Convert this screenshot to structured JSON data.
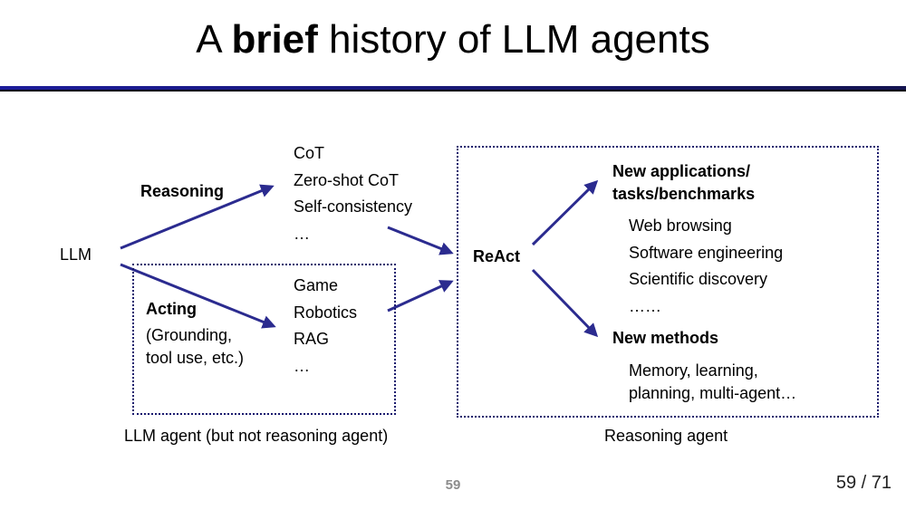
{
  "slide": {
    "title_prefix": "A ",
    "title_bold": "brief",
    "title_suffix": " history of LLM agents",
    "slide_number": "59",
    "page_counter": "59 / 71"
  },
  "diagram": {
    "root": "LLM",
    "reasoning_label": "Reasoning",
    "reasoning_items": [
      "CoT",
      "Zero-shot CoT",
      "Self-consistency",
      "…"
    ],
    "acting_label": "Acting",
    "acting_sub_1": "(Grounding,",
    "acting_sub_2": "tool use, etc.)",
    "acting_items": [
      "Game",
      "Robotics",
      "RAG",
      "…"
    ],
    "llm_agent_caption": "LLM agent (but not reasoning agent)",
    "react": "ReAct",
    "new_apps_1": "New applications/",
    "new_apps_2": "tasks/benchmarks",
    "app_items": [
      "Web browsing",
      "Software engineering",
      "Scientific discovery",
      "……"
    ],
    "new_methods": "New methods",
    "methods_1": "Memory, learning,",
    "methods_2": "planning, multi-agent…",
    "reasoning_agent_caption": "Reasoning agent"
  },
  "colors": {
    "arrow": "#2b2b8f",
    "title_rule": "#1c1c9a",
    "dotted_border": "#1a1a6e"
  }
}
